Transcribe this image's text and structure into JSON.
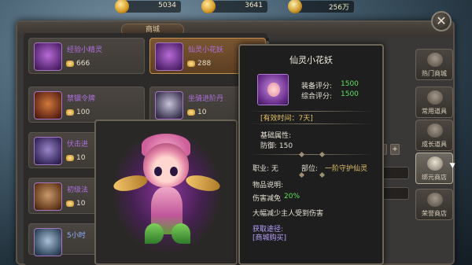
{
  "currency": {
    "ingot_bound": "5034",
    "ingot": "3641",
    "coins": "256万"
  },
  "panel": {
    "title": "商城",
    "close_label": "✕"
  },
  "shop_items": [
    {
      "name": "经验小精灵",
      "price": "666"
    },
    {
      "name": "仙灵小花妖",
      "price": "288"
    },
    {
      "name": "禁锢令牌",
      "price": "100"
    },
    {
      "name": "坐骑进阶丹",
      "price": "10"
    },
    {
      "name": "伏击进",
      "price": "10"
    },
    {
      "name": "初级法",
      "price": "10"
    },
    {
      "name": "5小时",
      "price": ""
    }
  ],
  "tabs": [
    {
      "label": "热门商城"
    },
    {
      "label": "常用道具"
    },
    {
      "label": "成长道具"
    },
    {
      "label": "绑元商店"
    },
    {
      "label": "荣誉商店"
    }
  ],
  "quantity_controls": {
    "minus": "-",
    "plus": "+"
  },
  "tooltip": {
    "title": "仙灵小花妖",
    "equip_score_label": "装备评分:",
    "equip_score": "1500",
    "total_score_label": "综合评分:",
    "total_score": "1500",
    "valid_time": "[有效时间：7天]",
    "base_attr_label": "基础属性:",
    "defense": "防御: 150",
    "job": "职业: 无",
    "slot_label": "部位:",
    "slot_value": "一阶守护仙灵",
    "desc_label": "物品说明:",
    "damage_reduce_label": "伤害减免",
    "damage_reduce_value": "20%",
    "desc_line": "大幅减少主人受到伤害",
    "source_label": "获取途径:",
    "source_value": "[商城购买]"
  }
}
